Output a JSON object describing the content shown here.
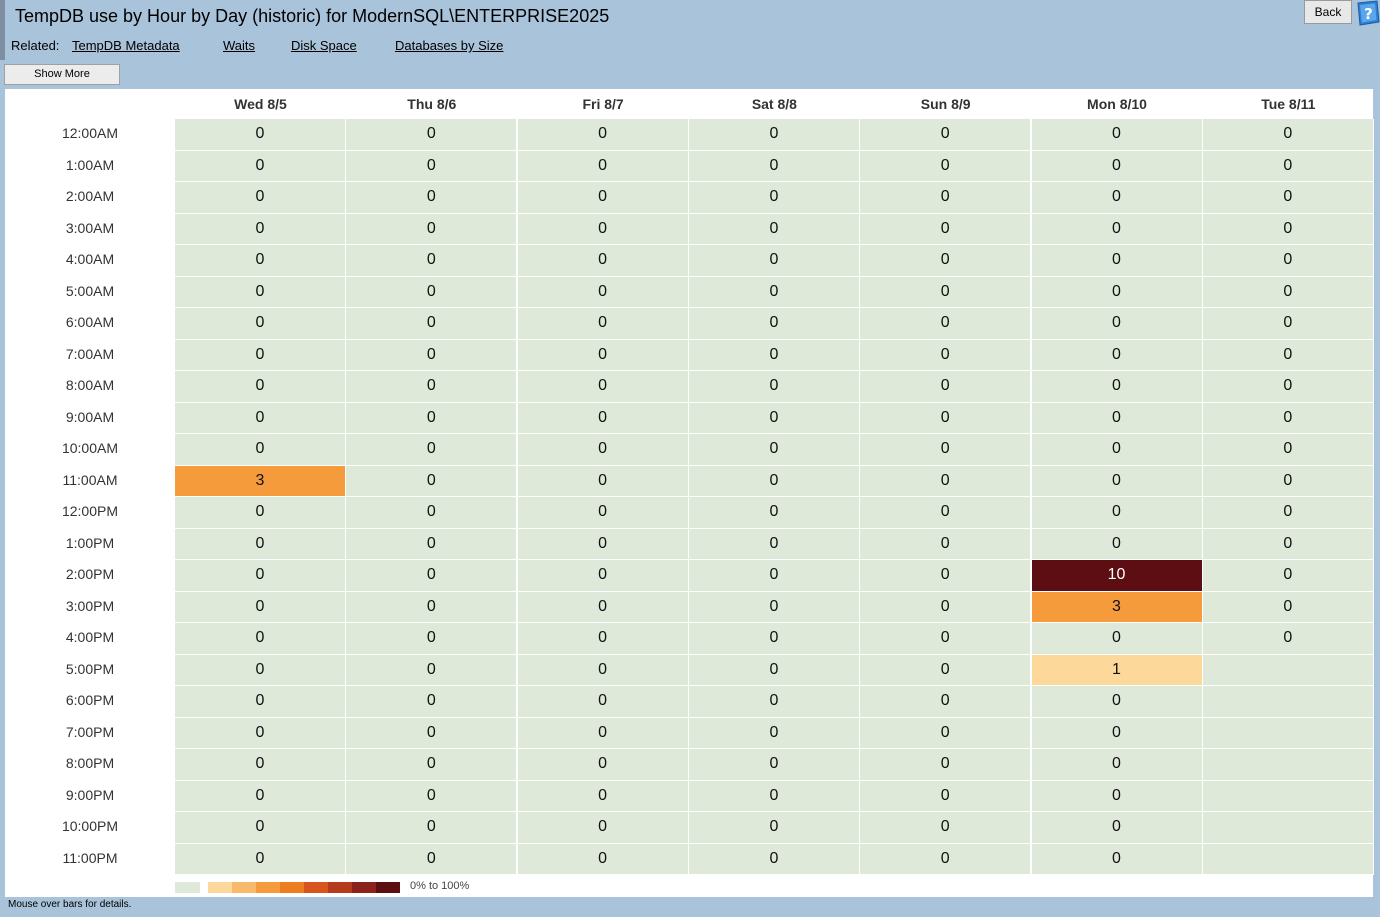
{
  "title": "TempDB use by Hour by Day (historic) for ModernSQL\\ENTERPRISE2025",
  "related": {
    "label": "Related:",
    "links": [
      "TempDB Metadata",
      "Waits",
      "Disk Space",
      "Databases by Size"
    ]
  },
  "toolbar": {
    "back_label": "Back",
    "help_icon": "help-question-icon",
    "show_more_label": "Show More"
  },
  "colors": {
    "background": "#a9c4da",
    "empty_cell": "#dfe9da",
    "legend_scale": [
      "#fcd99a",
      "#f9b96b",
      "#f59b3c",
      "#ee7d22",
      "#d8561e",
      "#b63a1c",
      "#8c231a",
      "#5d0e13"
    ]
  },
  "chart_data": {
    "type": "heatmap",
    "columns": [
      "Wed 8/5",
      "Thu 8/6",
      "Fri 8/7",
      "Sat 8/8",
      "Sun 8/9",
      "Mon 8/10",
      "Tue 8/11"
    ],
    "rows": [
      "12:00AM",
      "1:00AM",
      "2:00AM",
      "3:00AM",
      "4:00AM",
      "5:00AM",
      "6:00AM",
      "7:00AM",
      "8:00AM",
      "9:00AM",
      "10:00AM",
      "11:00AM",
      "12:00PM",
      "1:00PM",
      "2:00PM",
      "3:00PM",
      "4:00PM",
      "5:00PM",
      "6:00PM",
      "7:00PM",
      "8:00PM",
      "9:00PM",
      "10:00PM",
      "11:00PM"
    ],
    "values": [
      [
        0,
        0,
        0,
        0,
        0,
        0,
        0
      ],
      [
        0,
        0,
        0,
        0,
        0,
        0,
        0
      ],
      [
        0,
        0,
        0,
        0,
        0,
        0,
        0
      ],
      [
        0,
        0,
        0,
        0,
        0,
        0,
        0
      ],
      [
        0,
        0,
        0,
        0,
        0,
        0,
        0
      ],
      [
        0,
        0,
        0,
        0,
        0,
        0,
        0
      ],
      [
        0,
        0,
        0,
        0,
        0,
        0,
        0
      ],
      [
        0,
        0,
        0,
        0,
        0,
        0,
        0
      ],
      [
        0,
        0,
        0,
        0,
        0,
        0,
        0
      ],
      [
        0,
        0,
        0,
        0,
        0,
        0,
        0
      ],
      [
        0,
        0,
        0,
        0,
        0,
        0,
        0
      ],
      [
        3,
        0,
        0,
        0,
        0,
        0,
        0
      ],
      [
        0,
        0,
        0,
        0,
        0,
        0,
        0
      ],
      [
        0,
        0,
        0,
        0,
        0,
        0,
        0
      ],
      [
        0,
        0,
        0,
        0,
        0,
        10,
        0
      ],
      [
        0,
        0,
        0,
        0,
        0,
        3,
        0
      ],
      [
        0,
        0,
        0,
        0,
        0,
        0,
        0
      ],
      [
        0,
        0,
        0,
        0,
        0,
        1,
        null
      ],
      [
        0,
        0,
        0,
        0,
        0,
        0,
        null
      ],
      [
        0,
        0,
        0,
        0,
        0,
        0,
        null
      ],
      [
        0,
        0,
        0,
        0,
        0,
        0,
        null
      ],
      [
        0,
        0,
        0,
        0,
        0,
        0,
        null
      ],
      [
        0,
        0,
        0,
        0,
        0,
        0,
        null
      ],
      [
        0,
        0,
        0,
        0,
        0,
        0,
        null
      ]
    ],
    "value_range": [
      0,
      10
    ],
    "legend_label": "0% to 100%",
    "legend_placement": "bottom-left"
  },
  "status_text": "Mouse over bars for details."
}
